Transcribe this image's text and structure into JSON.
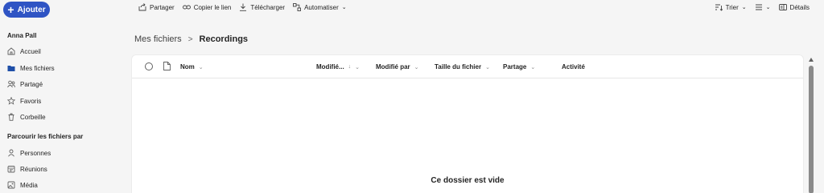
{
  "toolbar": {
    "add_label": "Ajouter",
    "share_label": "Partager",
    "copy_link_label": "Copier le lien",
    "download_label": "Télécharger",
    "automate_label": "Automatiser",
    "sort_label": "Trier",
    "details_label": "Détails"
  },
  "sidebar": {
    "user_name": "Anna Pall",
    "items": [
      {
        "label": "Accueil",
        "icon": "home-icon"
      },
      {
        "label": "Mes fichiers",
        "icon": "folder-icon"
      },
      {
        "label": "Partagé",
        "icon": "people-icon"
      },
      {
        "label": "Favoris",
        "icon": "star-icon"
      },
      {
        "label": "Corbeille",
        "icon": "trash-icon"
      }
    ],
    "browse_title": "Parcourir les fichiers par",
    "browse_items": [
      {
        "label": "Personnes",
        "icon": "person-icon"
      },
      {
        "label": "Réunions",
        "icon": "calendar-icon"
      },
      {
        "label": "Média",
        "icon": "image-icon"
      }
    ]
  },
  "breadcrumb": {
    "root": "Mes fichiers",
    "separator": ">",
    "current": "Recordings"
  },
  "table": {
    "columns": {
      "name": "Nom",
      "modified": "Modifié...",
      "modified_by": "Modifié par",
      "size": "Taille du fichier",
      "sharing": "Partage",
      "activity": "Activité"
    }
  },
  "empty_message": "Ce dossier est vide",
  "colors": {
    "accent": "#2f54c4",
    "folder_active": "#1f4fa8"
  }
}
